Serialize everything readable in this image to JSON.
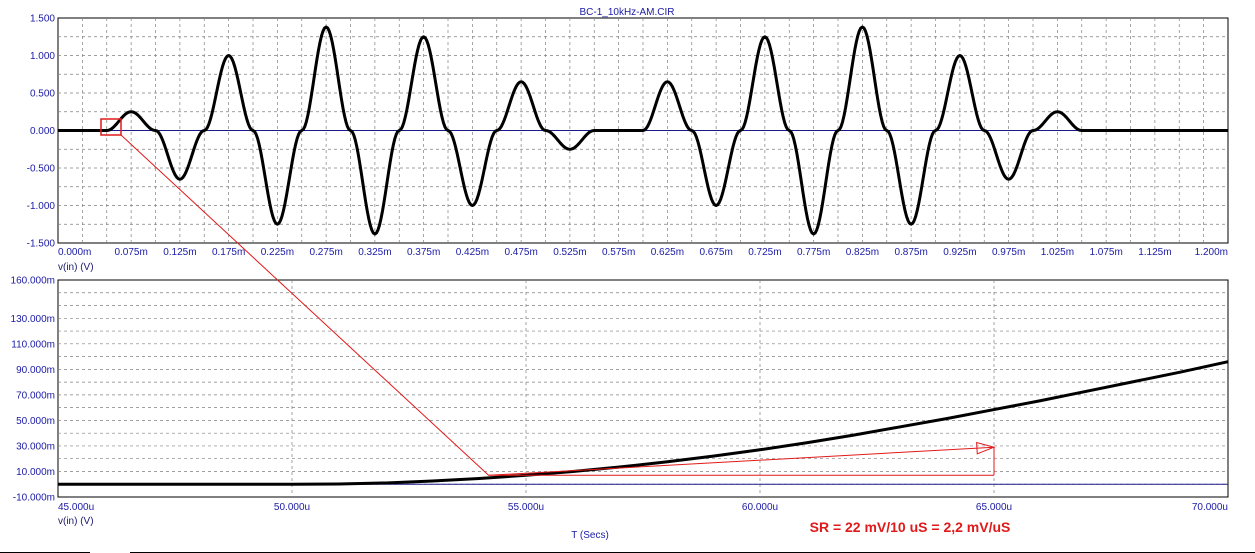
{
  "window": {
    "title": "BC-1_10kHz-AM.CIR"
  },
  "annotation": {
    "text": "SR = 22 mV/10 uS = 2,2 mV/uS",
    "color": "#e01a1a"
  },
  "colors": {
    "trace": "#000000",
    "axis_text": "#1a1aa6",
    "zero_line": "#1a1a8c",
    "grid": "#808080",
    "highlight": "#e01a1a"
  },
  "chart_data": [
    {
      "type": "line",
      "title": "BC-1_10kHz-AM.CIR",
      "ylabel": "v(in) (V)",
      "xlabel": "",
      "xlim": [
        0.0,
        1.2
      ],
      "ylim": [
        -1.5,
        1.5
      ],
      "x_unit": "ms",
      "grid": true,
      "xticks": [
        0.0,
        0.075,
        0.125,
        0.175,
        0.225,
        0.275,
        0.325,
        0.375,
        0.425,
        0.475,
        0.525,
        0.575,
        0.625,
        0.675,
        0.725,
        0.775,
        0.825,
        0.875,
        0.925,
        0.975,
        1.025,
        1.075,
        1.125,
        1.2
      ],
      "xtick_labels": [
        "0.000m",
        "0.075m",
        "0.125m",
        "0.175m",
        "0.225m",
        "0.275m",
        "0.325m",
        "0.375m",
        "0.425m",
        "0.475m",
        "0.525m",
        "0.575m",
        "0.625m",
        "0.675m",
        "0.725m",
        "0.775m",
        "0.825m",
        "0.875m",
        "0.925m",
        "0.975m",
        "1.025m",
        "1.075m",
        "1.125m",
        "1.200m"
      ],
      "yticks": [
        1.5,
        1.0,
        0.5,
        0.0,
        -0.5,
        -1.0,
        -1.5
      ],
      "ytick_labels": [
        "1.500",
        "1.000",
        "0.500",
        "0.000",
        "-0.500",
        "-1.000",
        "-1.500"
      ],
      "series": [
        {
          "name": "v(in)",
          "x": [
            0.05,
            0.075,
            0.1,
            0.125,
            0.15,
            0.175,
            0.2,
            0.225,
            0.25,
            0.275,
            0.3,
            0.325,
            0.35,
            0.375,
            0.4,
            0.425,
            0.45,
            0.475,
            0.5,
            0.525,
            0.55,
            0.575,
            0.6,
            0.625,
            0.65,
            0.675,
            0.7,
            0.725,
            0.75,
            0.775,
            0.8,
            0.825,
            0.85,
            0.875,
            0.9,
            0.925,
            0.95,
            0.975,
            1.0,
            1.025,
            1.05
          ],
          "y": [
            0.0,
            0.25,
            0.0,
            -0.65,
            0.0,
            1.0,
            0.0,
            -1.25,
            0.0,
            1.38,
            0.0,
            -1.38,
            0.0,
            1.25,
            0.0,
            -1.0,
            0.0,
            0.65,
            0.0,
            -0.25,
            0.0,
            0.0,
            0.0,
            0.65,
            0.0,
            -1.0,
            0.0,
            1.25,
            0.0,
            -1.38,
            0.0,
            1.38,
            0.0,
            -1.25,
            0.0,
            1.0,
            0.0,
            -0.65,
            0.0,
            0.25,
            0.0
          ]
        }
      ]
    },
    {
      "type": "line",
      "title": "",
      "ylabel": "v(in) (V)",
      "xlabel": "T (Secs)",
      "xlim": [
        45.0,
        70.0
      ],
      "ylim": [
        -10.0,
        160.0
      ],
      "x_unit": "us",
      "y_unit": "mV",
      "grid": true,
      "xticks": [
        45.0,
        50.0,
        55.0,
        60.0,
        65.0,
        70.0
      ],
      "xtick_labels": [
        "45.000u",
        "50.000u",
        "55.000u",
        "60.000u",
        "65.000u",
        "70.000u"
      ],
      "yticks": [
        160.0,
        130.0,
        110.0,
        90.0,
        70.0,
        50.0,
        30.0,
        10.0,
        -10.0
      ],
      "ytick_labels": [
        "160.000m",
        "130.000m",
        "110.000m",
        "90.000m",
        "70.000m",
        "50.000m",
        "30.000m",
        "10.000m",
        "-10.000m"
      ],
      "series": [
        {
          "name": "v(in)",
          "x": [
            45.0,
            48.0,
            50.0,
            51.0,
            52.0,
            53.0,
            54.0,
            55.0,
            56.0,
            57.0,
            58.0,
            59.0,
            60.0,
            61.0,
            62.0,
            63.0,
            64.0,
            65.0,
            66.0,
            67.0,
            68.0,
            69.0,
            70.0
          ],
          "y": [
            0.0,
            0.0,
            0.0,
            0.2,
            1.0,
            2.5,
            4.5,
            7.0,
            10.0,
            13.5,
            17.5,
            22.0,
            27.0,
            32.5,
            38.5,
            45.0,
            51.5,
            58.5,
            65.5,
            73.0,
            80.5,
            88.0,
            96.0
          ]
        }
      ],
      "slope_marker": {
        "x": [
          54.2,
          65.0,
          65.0
        ],
        "y": [
          7.0,
          7.0,
          29.0
        ]
      }
    }
  ]
}
